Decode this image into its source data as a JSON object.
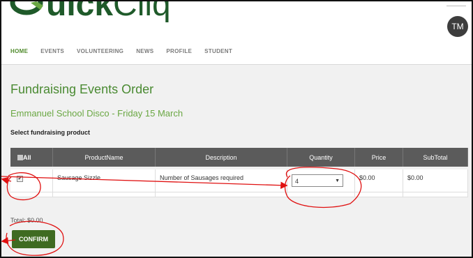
{
  "logo": {
    "text_bold": "uick",
    "text_light": "Cliq"
  },
  "user": {
    "initials": "TM"
  },
  "nav": [
    "HOME",
    "EVENTS",
    "VOLUNTEERING",
    "NEWS",
    "PROFILE",
    "STUDENT"
  ],
  "page": {
    "title": "Fundraising Events Order",
    "subtitle": "Emmanuel School Disco - Friday 15 March",
    "select_label": "Select fundraising product"
  },
  "table": {
    "headers": [
      "All",
      "ProductName",
      "Description",
      "Quantity",
      "Price",
      "SubTotal"
    ],
    "rows": [
      {
        "product": "Sausage Sizzle",
        "description": "Number of Sausages required",
        "quantity": "4",
        "price": "$0.00",
        "subtotal": "$0.00",
        "checked": "✔"
      }
    ]
  },
  "total": "Total: $0.00",
  "confirm_label": "CONFIRM",
  "colors": {
    "brand_green": "#3f6b22",
    "title_green": "#4a8a32",
    "annotation_red": "#e01010"
  }
}
